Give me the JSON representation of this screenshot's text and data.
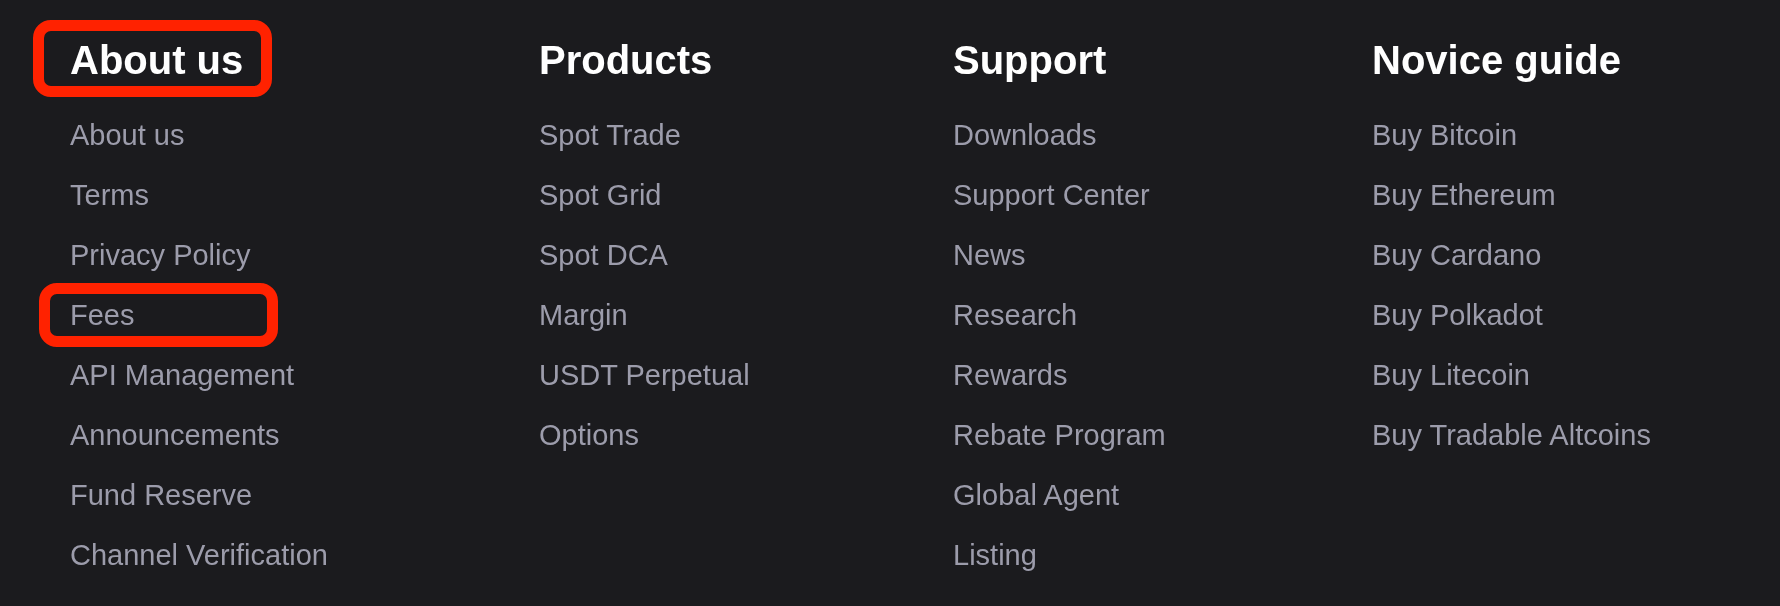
{
  "columns": [
    {
      "heading": {
        "text": "About us",
        "highlighted": true
      },
      "links": [
        {
          "label": "About us",
          "highlighted": false
        },
        {
          "label": "Terms",
          "highlighted": false
        },
        {
          "label": "Privacy Policy",
          "highlighted": false
        },
        {
          "label": "Fees",
          "highlighted": true
        },
        {
          "label": "API Management",
          "highlighted": false
        },
        {
          "label": "Announcements",
          "highlighted": false
        },
        {
          "label": "Fund Reserve",
          "highlighted": false
        },
        {
          "label": "Channel Verification",
          "highlighted": false
        }
      ]
    },
    {
      "heading": {
        "text": "Products",
        "highlighted": false
      },
      "links": [
        {
          "label": "Spot Trade",
          "highlighted": false
        },
        {
          "label": "Spot Grid",
          "highlighted": false
        },
        {
          "label": "Spot DCA",
          "highlighted": false
        },
        {
          "label": "Margin",
          "highlighted": false
        },
        {
          "label": "USDT Perpetual",
          "highlighted": false
        },
        {
          "label": "Options",
          "highlighted": false
        }
      ]
    },
    {
      "heading": {
        "text": "Support",
        "highlighted": false
      },
      "links": [
        {
          "label": "Downloads",
          "highlighted": false
        },
        {
          "label": "Support Center",
          "highlighted": false
        },
        {
          "label": "News",
          "highlighted": false
        },
        {
          "label": "Research",
          "highlighted": false
        },
        {
          "label": "Rewards",
          "highlighted": false
        },
        {
          "label": "Rebate Program",
          "highlighted": false
        },
        {
          "label": "Global Agent",
          "highlighted": false
        },
        {
          "label": "Listing",
          "highlighted": false
        }
      ]
    },
    {
      "heading": {
        "text": "Novice guide",
        "highlighted": false
      },
      "links": [
        {
          "label": "Buy Bitcoin",
          "highlighted": false
        },
        {
          "label": "Buy Ethereum",
          "highlighted": false
        },
        {
          "label": "Buy Cardano",
          "highlighted": false
        },
        {
          "label": "Buy Polkadot",
          "highlighted": false
        },
        {
          "label": "Buy Litecoin",
          "highlighted": false
        },
        {
          "label": "Buy Tradable Altcoins",
          "highlighted": false
        }
      ]
    }
  ]
}
